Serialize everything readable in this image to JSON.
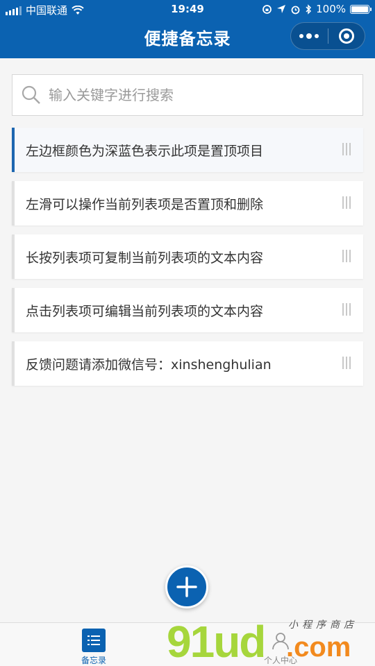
{
  "status_bar": {
    "carrier": "中国联通",
    "time": "19:49",
    "battery": "100%"
  },
  "nav": {
    "title": "便捷备忘录"
  },
  "search": {
    "placeholder": "输入关键字进行搜索"
  },
  "memos": [
    {
      "text": "左边框颜色为深蓝色表示此项是置顶项目",
      "pinned": true
    },
    {
      "text": "左滑可以操作当前列表项是否置顶和删除",
      "pinned": false
    },
    {
      "text": "长按列表项可复制当前列表项的文本内容",
      "pinned": false
    },
    {
      "text": "点击列表项可编辑当前列表项的文本内容",
      "pinned": false
    },
    {
      "text": "反馈问题请添加微信号：xinshenghulian",
      "pinned": false
    }
  ],
  "tabbar": {
    "memo_label": "备忘录",
    "me_label": "个人中心"
  },
  "watermark": {
    "brand": "91ud",
    "domain": ".com",
    "subtitle": "小程序商店"
  },
  "colors": {
    "primary": "#0b62b1",
    "pinned_border": "#1d66b0",
    "normal_border": "#e0e0e0",
    "background": "#f5f5f5"
  },
  "icons": {
    "menu_dots": "more-dots-icon",
    "close_target": "mini-program-exit-icon",
    "search": "search-icon",
    "add": "plus-icon",
    "memo_tab": "list-icon",
    "me_tab": "person-icon"
  }
}
